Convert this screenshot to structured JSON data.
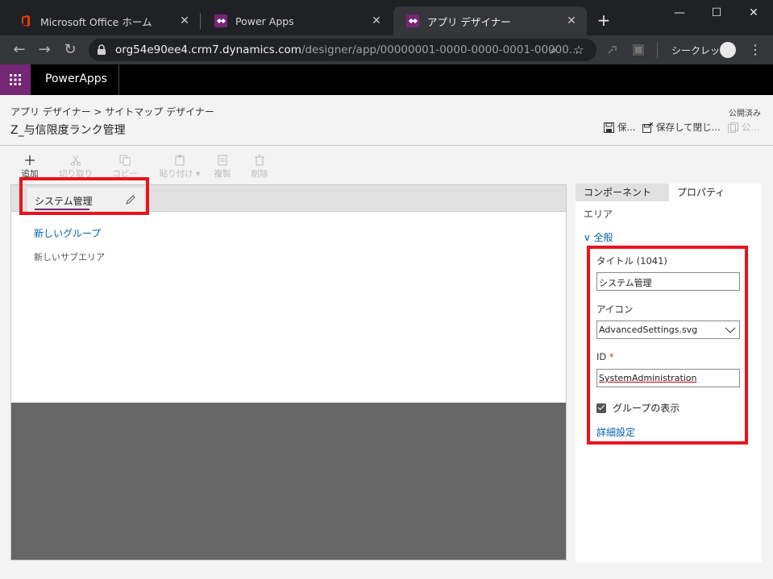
{
  "browser": {
    "tabs": [
      {
        "title": "Microsoft Office ホーム",
        "active": false,
        "icon": "office-icon"
      },
      {
        "title": "Power Apps",
        "active": false,
        "icon": "powerapps-icon"
      },
      {
        "title": "アプリ デザイナー",
        "active": true,
        "icon": "powerapps-icon"
      }
    ],
    "url_host": "org54e90ee4.crm7.dynamics.com",
    "url_path": "/designer/app/00000001-0000-0000-0001-00000...",
    "incognito_label": "シークレット"
  },
  "app": {
    "name": "PowerApps"
  },
  "header": {
    "breadcrumb_parent": "アプリ デザイナー",
    "breadcrumb_sep": ">",
    "breadcrumb_current": "サイトマップ デザイナー",
    "title": "Z_与信限度ランク管理",
    "publish_status": "公開済み",
    "save_label": "保...",
    "save_close_label": "保存して閉じ...",
    "publish_label": "公..."
  },
  "toolbar": {
    "add": "追加",
    "cut": "切り取り",
    "copy": "コピー",
    "paste": "貼り付け",
    "clone": "複製",
    "delete": "削除"
  },
  "canvas": {
    "area_title": "システム管理",
    "group_title": "新しいグループ",
    "subarea_title": "新しいサブエリア"
  },
  "properties": {
    "tab_components": "コンポーネント",
    "tab_properties": "プロパティ",
    "type_label": "エリア",
    "section_general": "全般",
    "title_label": "タイトル (1041)",
    "title_value": "システム管理",
    "icon_label": "アイコン",
    "icon_value": "AdvancedSettings.svg",
    "id_label": "ID",
    "id_required_mark": "*",
    "id_value": "SystemAdministration",
    "show_groups_label": "グループの表示",
    "show_groups_checked": true,
    "advanced_link": "詳細設定"
  },
  "colors": {
    "brand_purple": "#742774",
    "highlight_red": "#e8141d",
    "link_blue": "#0062ab"
  }
}
